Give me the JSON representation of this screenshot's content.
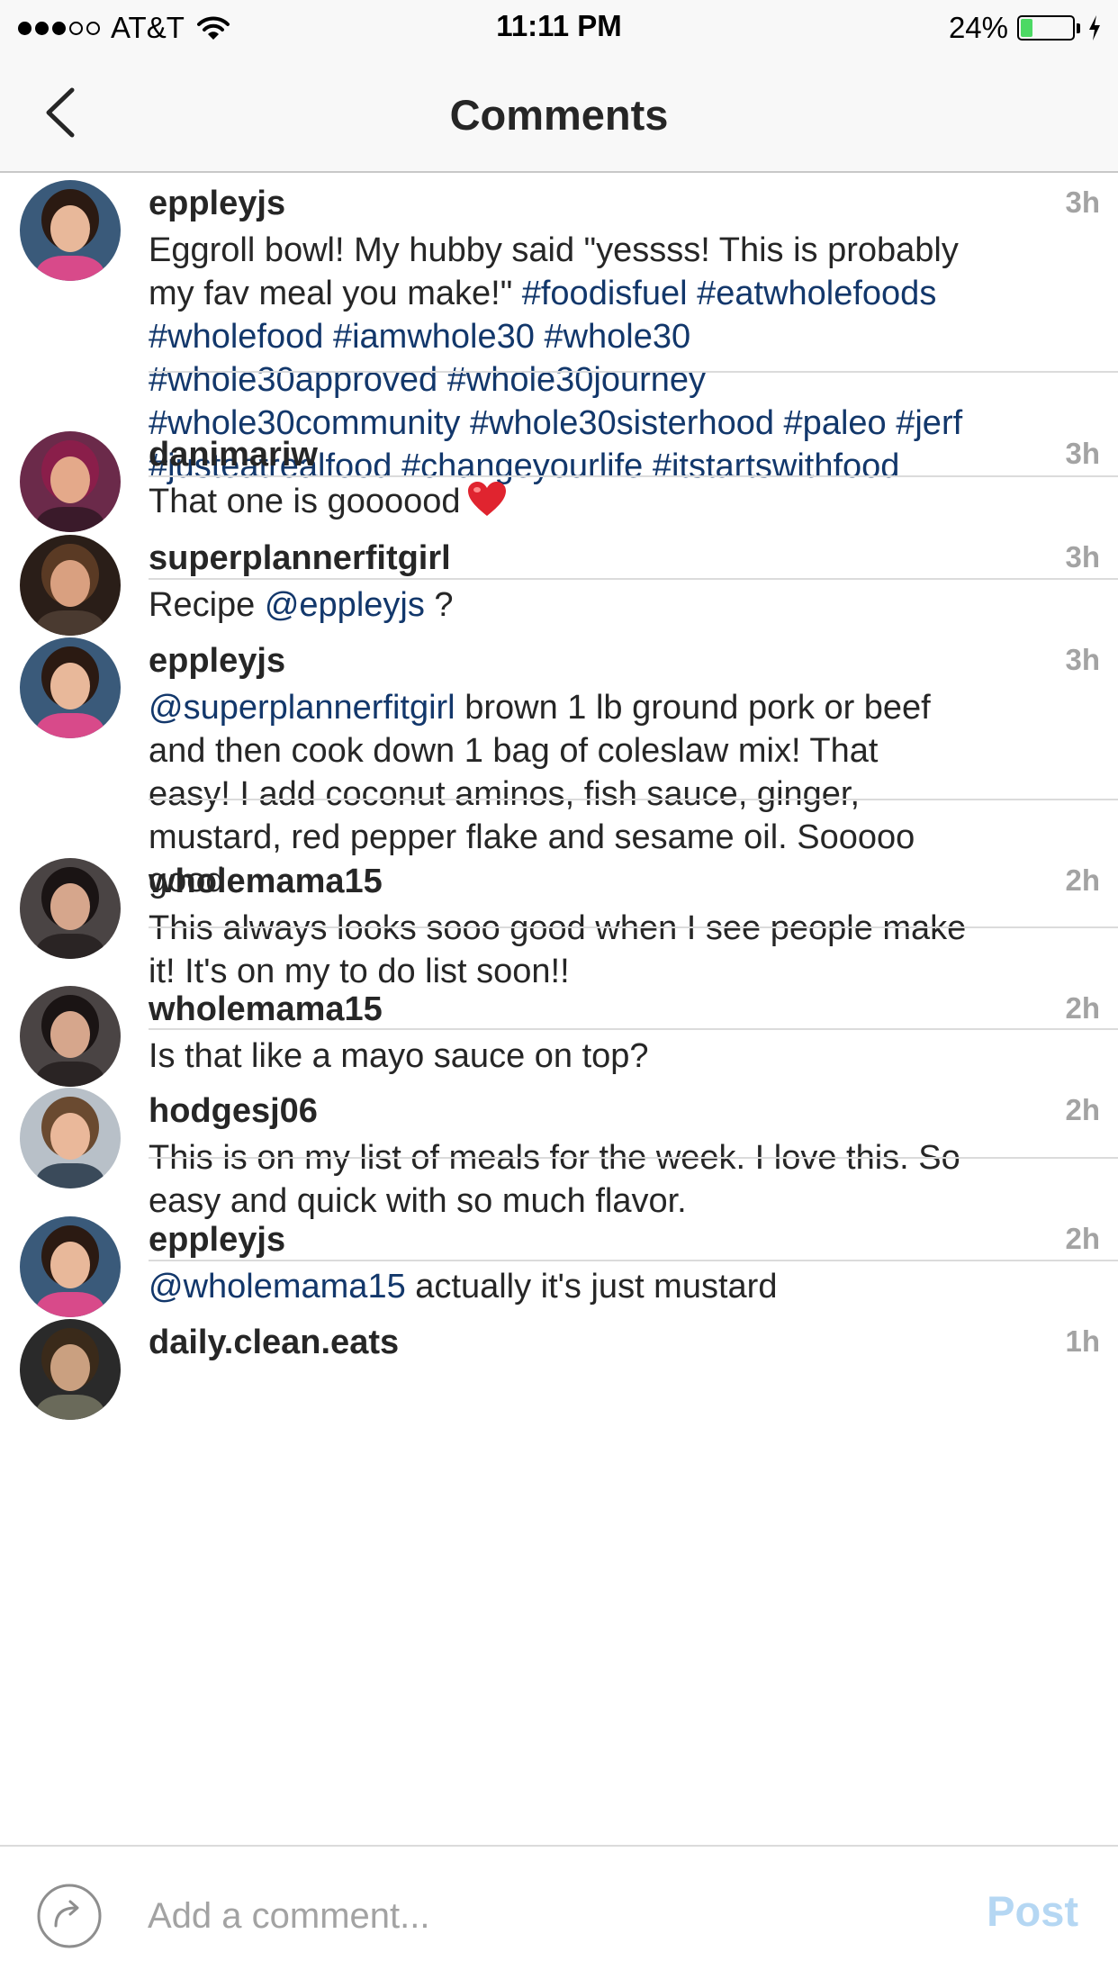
{
  "status_bar": {
    "carrier": "AT&T",
    "time": "11:11 PM",
    "battery": "24%",
    "battery_level": 0.24,
    "signal_bars": 3,
    "icons": [
      "signal-dots-icon",
      "wifi-icon",
      "battery-icon",
      "charging-bolt-icon"
    ]
  },
  "nav": {
    "title": "Comments",
    "back_icon": "chevron-left-icon"
  },
  "comments": [
    {
      "username": "eppleyjs",
      "time": "3h",
      "lines": [
        [
          {
            "t": "Eggroll bowl! My hubby said \"yessss! This is probably"
          }
        ],
        [
          {
            "t": "my fav meal you make!\" "
          },
          {
            "t": "#foodisfuel",
            "tag": true
          },
          {
            "t": " "
          },
          {
            "t": "#eatwholefoods",
            "tag": true
          }
        ],
        [
          {
            "t": "#wholefood",
            "tag": true
          },
          {
            "t": " "
          },
          {
            "t": "#iamwhole30",
            "tag": true
          },
          {
            "t": " "
          },
          {
            "t": "#whole30",
            "tag": true
          }
        ],
        [
          {
            "t": "#whole30approved",
            "tag": true
          },
          {
            "t": " "
          },
          {
            "t": "#whole30journey",
            "tag": true
          }
        ],
        [
          {
            "t": "#whole30community",
            "tag": true
          },
          {
            "t": " "
          },
          {
            "t": "#whole30sisterhood",
            "tag": true
          },
          {
            "t": " "
          },
          {
            "t": "#paleo",
            "tag": true
          },
          {
            "t": " "
          },
          {
            "t": "#jerf",
            "tag": true
          }
        ],
        [
          {
            "t": "#justeatrealfood",
            "tag": true
          },
          {
            "t": " "
          },
          {
            "t": "#changeyourlife",
            "tag": true
          },
          {
            "t": " "
          },
          {
            "t": "#itstartswithfood",
            "tag": true
          }
        ]
      ]
    },
    {
      "username": "danimariw",
      "time": "3h",
      "lines": [
        [
          {
            "t": "That one is goooood"
          },
          {
            "t": "",
            "heart": true
          }
        ]
      ]
    },
    {
      "username": "superplannerfitgirl",
      "time": "3h",
      "lines": [
        [
          {
            "t": "Recipe "
          },
          {
            "t": "@eppleyjs",
            "tag": true
          },
          {
            "t": " ?"
          }
        ]
      ]
    },
    {
      "username": "eppleyjs",
      "time": "3h",
      "lines": [
        [
          {
            "t": "@superplannerfitgirl",
            "tag": true
          },
          {
            "t": " brown 1 lb ground pork or beef"
          }
        ],
        [
          {
            "t": "and then cook down 1 bag of coleslaw mix! That"
          }
        ],
        [
          {
            "t": "easy! I add coconut aminos, fish sauce, ginger,"
          }
        ],
        [
          {
            "t": "mustard, red pepper flake and sesame oil. Sooooo"
          }
        ],
        [
          {
            "t": "good"
          }
        ]
      ]
    },
    {
      "username": "wholemama15",
      "time": "2h",
      "lines": [
        [
          {
            "t": "This always looks sooo good when I see people make"
          }
        ],
        [
          {
            "t": "it! It's on my to do list soon!!"
          }
        ]
      ]
    },
    {
      "username": "wholemama15",
      "time": "2h",
      "lines": [
        [
          {
            "t": "Is that like a mayo sauce on top?"
          }
        ]
      ]
    },
    {
      "username": "hodgesj06",
      "time": "2h",
      "lines": [
        [
          {
            "t": "This is on my list of meals for the week. I love this. So"
          }
        ],
        [
          {
            "t": "easy and quick with so much flavor."
          }
        ]
      ]
    },
    {
      "username": "eppleyjs",
      "time": "2h",
      "lines": [
        [
          {
            "t": "@wholemama15",
            "tag": true
          },
          {
            "t": " actually it's just mustard"
          }
        ]
      ]
    },
    {
      "username": "daily.clean.eats",
      "time": "1h",
      "lines": []
    }
  ],
  "composer": {
    "placeholder": "Add a comment...",
    "post_label": "Post",
    "share_icon": "share-arrow-icon"
  },
  "colors": {
    "hashtag": "#12376b",
    "post_disabled": "#b5d7f3",
    "timestamp": "#a3a3a3",
    "battery_fill": "#4cd964"
  }
}
